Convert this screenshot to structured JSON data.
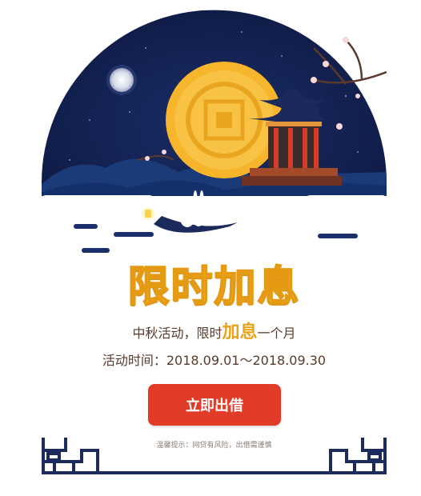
{
  "banner": {
    "headline": "限时加息",
    "subtitle_prefix": "中秋活动，限时",
    "subtitle_highlight": "加息",
    "subtitle_suffix": "一个月",
    "period": "活动时间：2018.09.01～2018.09.30",
    "cta_label": "立即出借",
    "risk_notice": "温馨提示：网贷有风险，出借需谨慎"
  },
  "colors": {
    "sky": "#0f1c4a",
    "moon": "#f6b52a",
    "headline": "#f7c32e",
    "cta": "#e03c27",
    "frame": "#1c2a5c"
  },
  "icons": [
    "moon-icon",
    "pavilion-icon",
    "rabbit-icon",
    "lantern-icon",
    "blossom-icon",
    "lattice-frame-icon"
  ]
}
